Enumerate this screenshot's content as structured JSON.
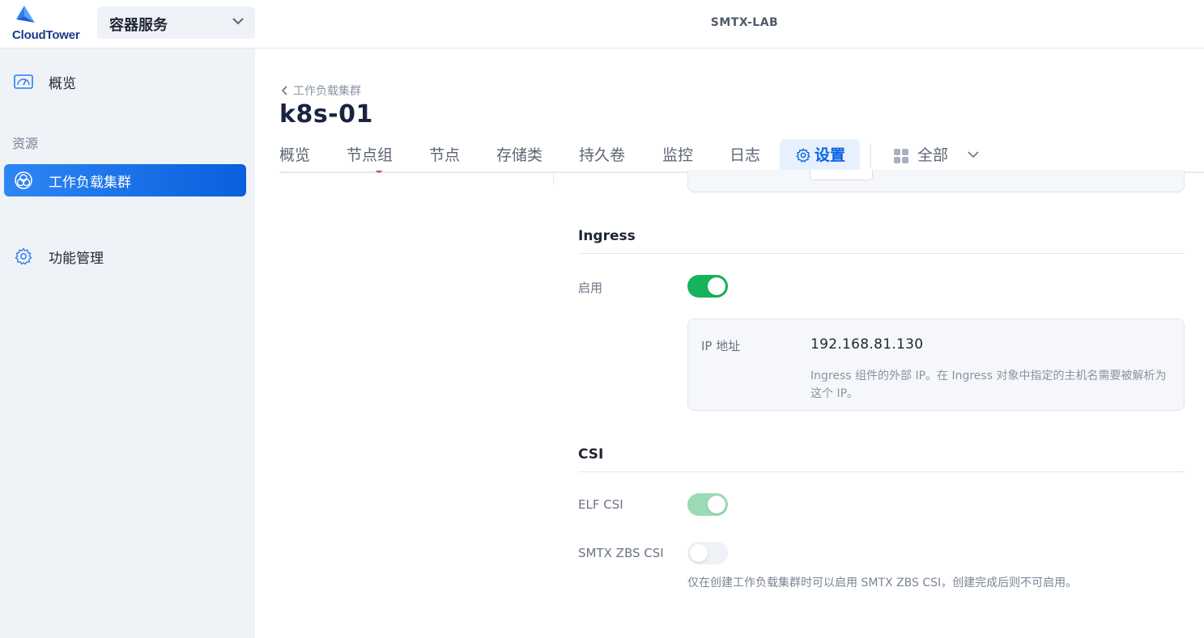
{
  "app": {
    "logo_text": "CloudTower",
    "product": "容器服务",
    "cluster_name": "SMTX-LAB"
  },
  "sidebar": {
    "items": [
      {
        "label": "概览",
        "icon": "dashboard-icon"
      },
      {
        "label": "工作负载集群",
        "icon": "cluster-icon",
        "active": true
      },
      {
        "label": "功能管理",
        "icon": "gear-icon"
      }
    ],
    "section_label": "资源"
  },
  "page": {
    "breadcrumb": "工作负载集群",
    "title": "k8s-01"
  },
  "tabs": [
    {
      "label": "概览"
    },
    {
      "label": "节点组"
    },
    {
      "label": "节点"
    },
    {
      "label": "存储类"
    },
    {
      "label": "持久卷"
    },
    {
      "label": "监控"
    },
    {
      "label": "日志"
    },
    {
      "label": "设置",
      "active": true
    }
  ],
  "tab_all": {
    "label": "全部"
  },
  "ingress": {
    "title": "Ingress",
    "enable_label": "启用",
    "enabled": true,
    "ip_label": "IP 地址",
    "ip_value": "192.168.81.130",
    "ip_description": "Ingress 组件的外部 IP。在 Ingress 对象中指定的主机名需要被解析为这个 IP。"
  },
  "csi": {
    "title": "CSI",
    "elf_label": "ELF CSI",
    "elf_enabled": true,
    "zbs_label": "SMTX ZBS CSI",
    "zbs_enabled": false,
    "zbs_hint": "仅在创建工作负载集群时可以启用 SMTX ZBS CSI，创建完成后则不可启用。"
  },
  "colors": {
    "accent": "#0a63e6",
    "toggle_on": "#15b35a",
    "sidebar_bg": "#eff2f7"
  }
}
